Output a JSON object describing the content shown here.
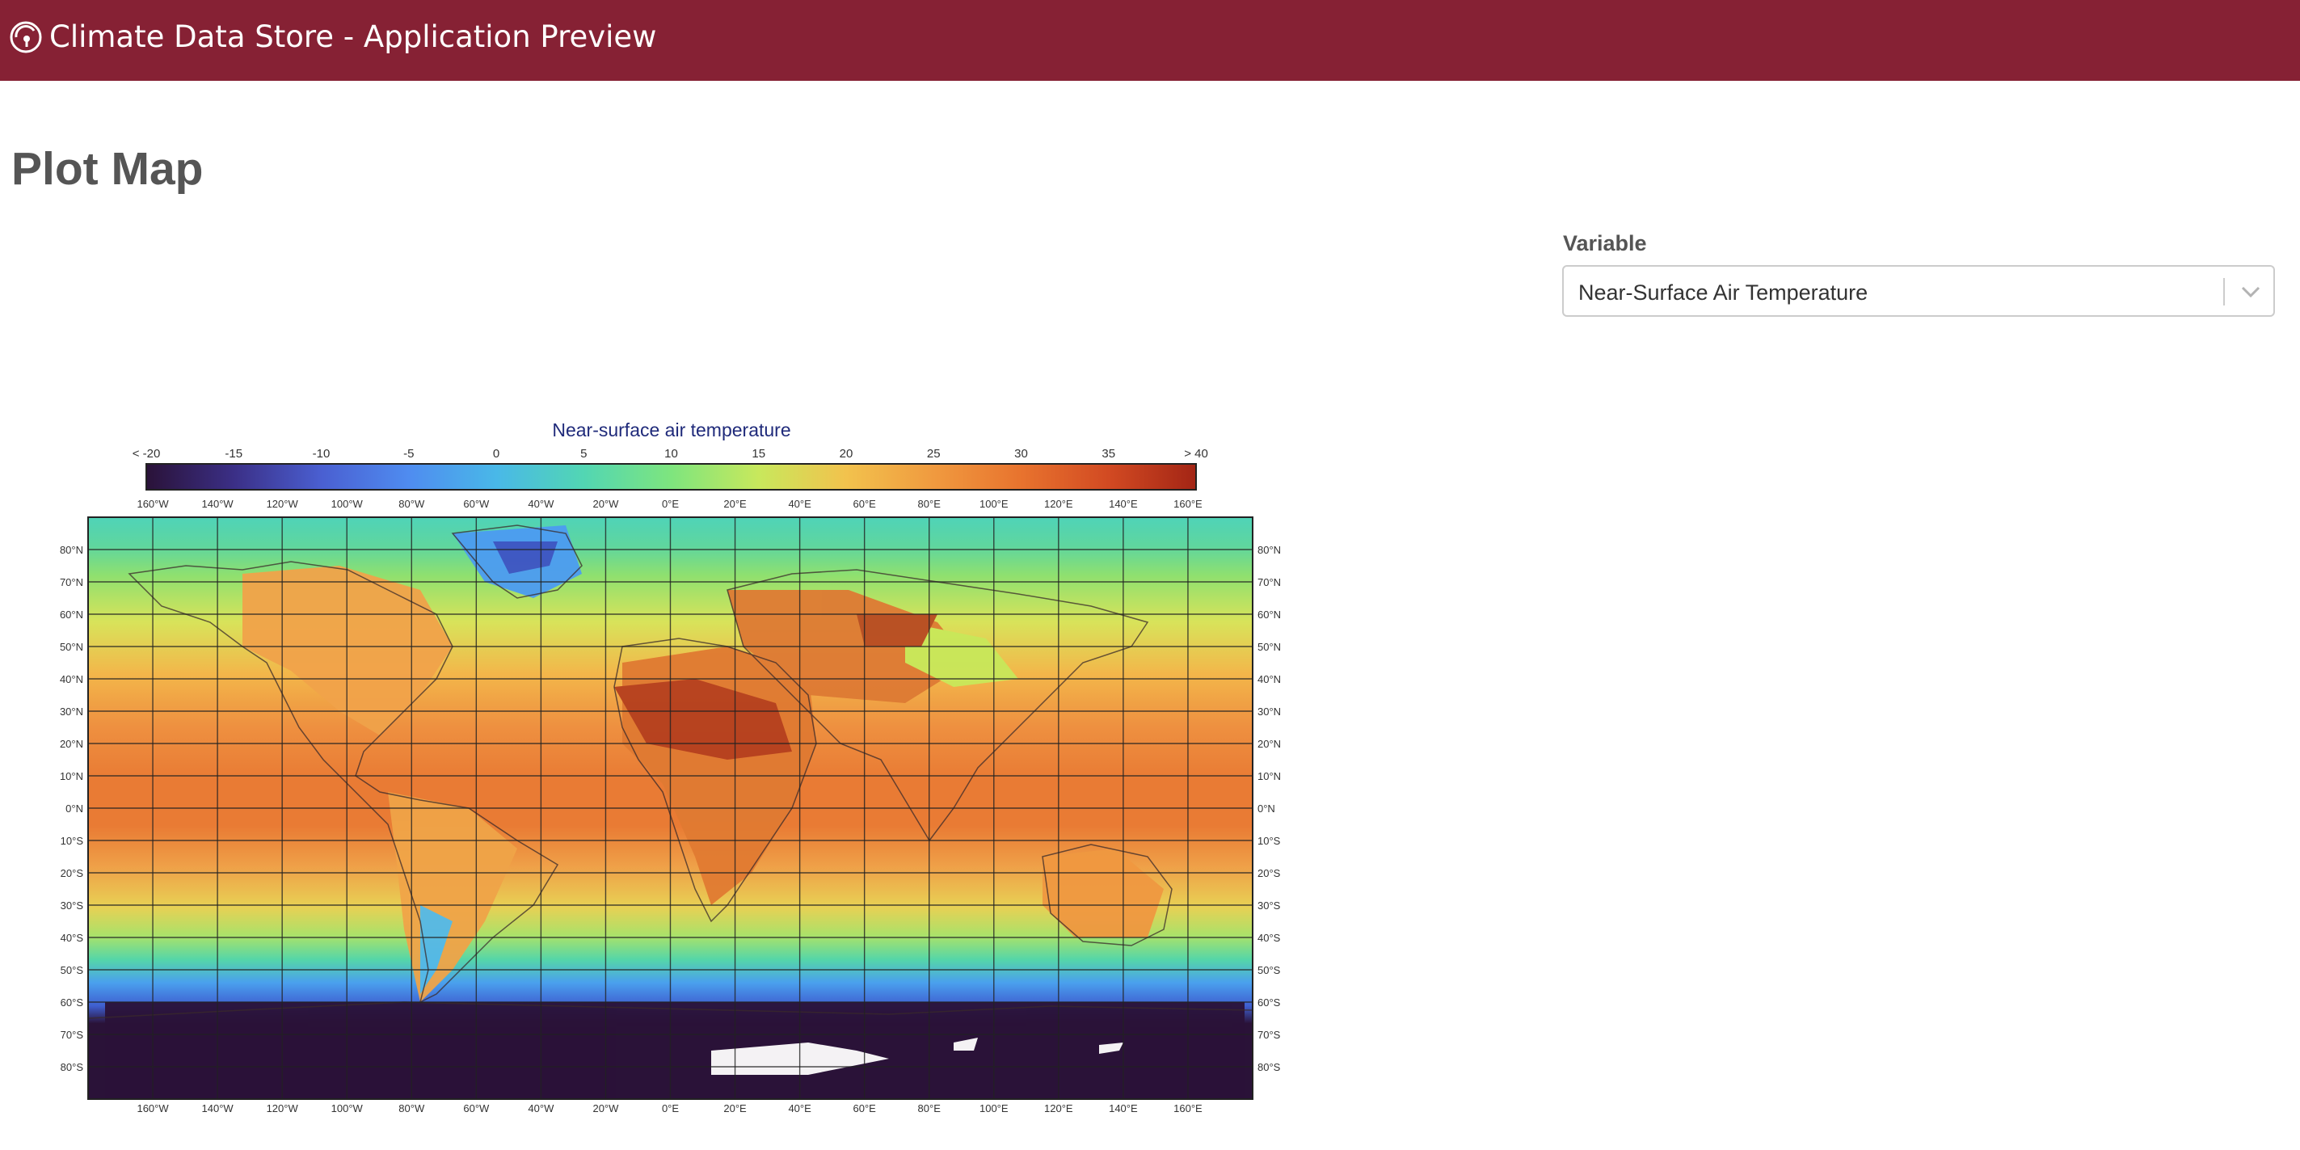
{
  "header": {
    "title": "Climate Data Store - Application Preview",
    "logo_icon": "cds-globe-logo-icon",
    "background": "#862134"
  },
  "page": {
    "title": "Plot Map"
  },
  "controls": {
    "variable_label": "Variable",
    "variable_value": "Near-Surface Air Temperature",
    "dropdown_icon": "chevron-down-icon"
  },
  "map": {
    "title": "Near-surface air temperature",
    "colorbar_ticks": [
      "< -20",
      "-15",
      "-10",
      "-5",
      "0",
      "5",
      "10",
      "15",
      "20",
      "25",
      "30",
      "35",
      "> 40"
    ],
    "colorbar_colors": [
      "#2a1238",
      "#3b2f86",
      "#4a5fd1",
      "#4f8cf0",
      "#49b8e8",
      "#52d6b3",
      "#7ee57e",
      "#c8e85c",
      "#f2c24d",
      "#f09a3f",
      "#e8732e",
      "#d24a22",
      "#a32515"
    ],
    "lon_labels": [
      "160°W",
      "140°W",
      "120°W",
      "100°W",
      "80°W",
      "60°W",
      "40°W",
      "20°W",
      "0°E",
      "20°E",
      "40°E",
      "60°E",
      "80°E",
      "100°E",
      "120°E",
      "140°E",
      "160°E"
    ],
    "lat_labels": [
      "80°N",
      "70°N",
      "60°N",
      "50°N",
      "40°N",
      "30°N",
      "20°N",
      "10°N",
      "0°N",
      "10°S",
      "20°S",
      "30°S",
      "40°S",
      "50°S",
      "60°S",
      "70°S",
      "80°S"
    ]
  }
}
